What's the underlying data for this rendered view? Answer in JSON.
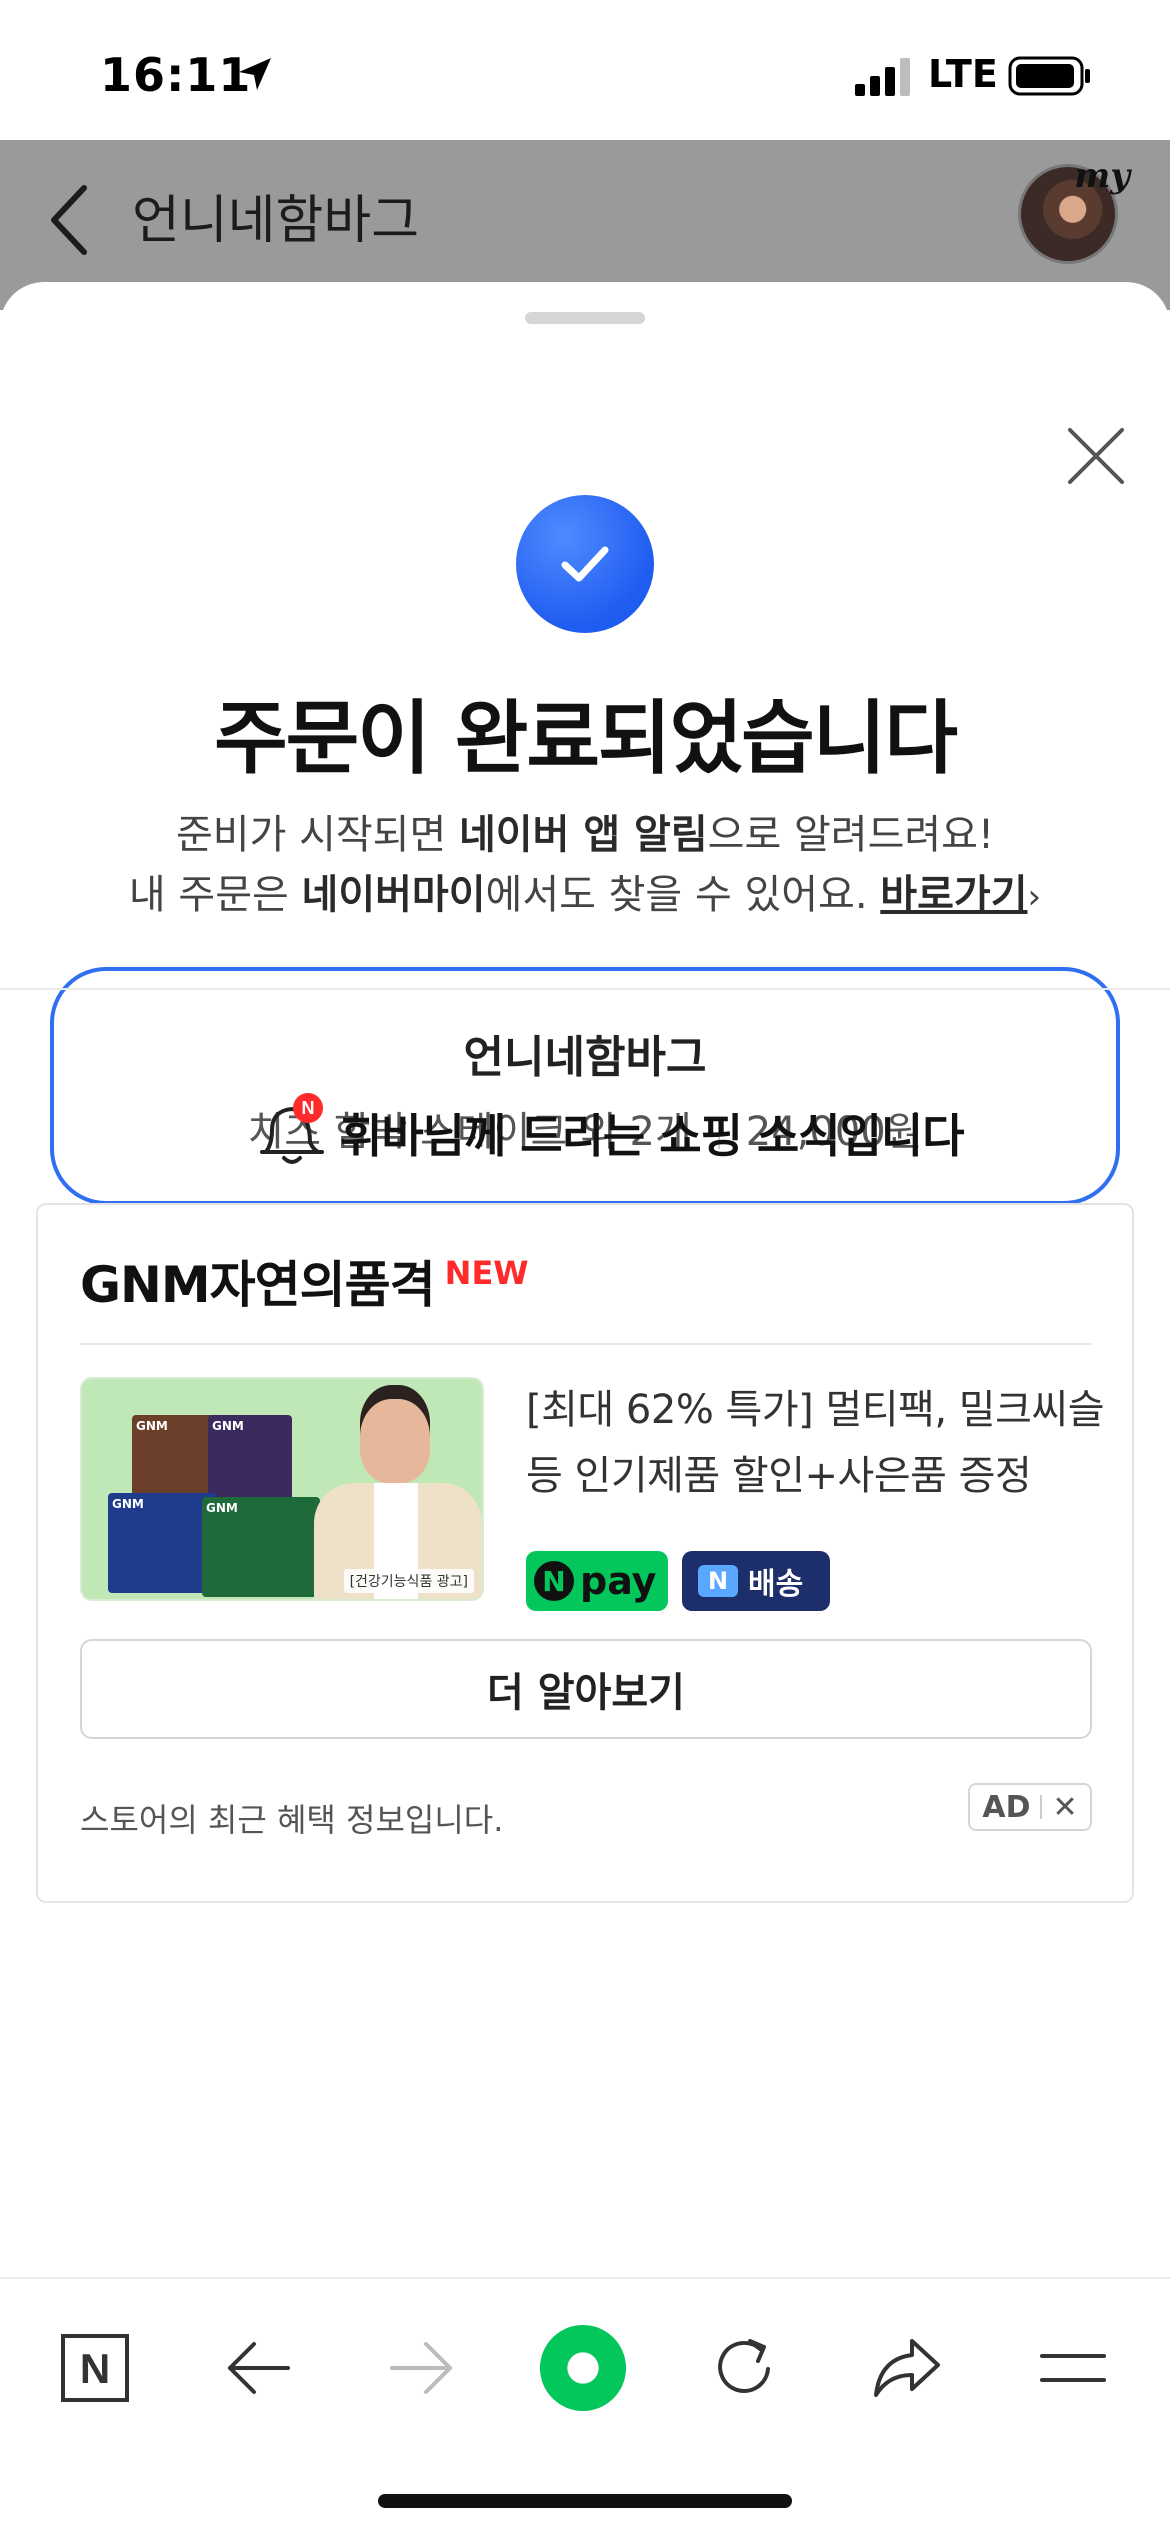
{
  "status_bar": {
    "time": "16:11",
    "network": "LTE"
  },
  "app_bar": {
    "title": "언니네함바그",
    "avatar_badge": "my"
  },
  "completion": {
    "headline": "주문이 완료되었습니다",
    "line1_pre": "준비가 시작되면 ",
    "line1_bold": "네이버 앱 알림",
    "line1_post": "으로 알려드려요!",
    "line2_pre": "내 주문은 ",
    "line2_bold": "네이버마이",
    "line2_post": "에서도 찾을 수 있어요. ",
    "shortcut_link": "바로가기",
    "shortcut_chevron": "›"
  },
  "order": {
    "store": "언니네함바그",
    "items": "치즈 함박 스테이크 외 2개",
    "price": "24,000원"
  },
  "news": {
    "title": "휘바님께 드리는 쇼핑 소식입니다",
    "bell_badge": "N"
  },
  "ad": {
    "brand": "GNM자연의품격",
    "brand_badge": "NEW",
    "description": "[최대 62% 특가] 멀티팩, 밀크씨슬 등 인기제품 할인+사은품 증정",
    "npay_label": "pay",
    "npay_mark": "N",
    "delivery_mark": "N",
    "delivery_label": "배송",
    "image_caption": "[건강기능식품 광고]",
    "image_box_labels": [
      "GNM",
      "GNM",
      "GNM",
      "GNM"
    ],
    "more_button": "더 알아보기",
    "footer_note": "스토어의 최근 혜택 정보입니다.",
    "ad_label": "AD",
    "ad_close": "✕"
  },
  "toolbar": {
    "naver_home": "N"
  },
  "colors": {
    "accent_blue": "#2f6ff2",
    "naver_green": "#03c75a",
    "new_red": "#ff2b2b"
  },
  "icons": [
    "location-arrow-icon",
    "signal-icon",
    "battery-icon",
    "back-chevron-icon",
    "close-icon",
    "check-icon",
    "bell-icon",
    "naver-home-icon",
    "arrow-left-icon",
    "arrow-right-icon",
    "green-dot-icon",
    "refresh-icon",
    "share-icon",
    "menu-icon"
  ]
}
